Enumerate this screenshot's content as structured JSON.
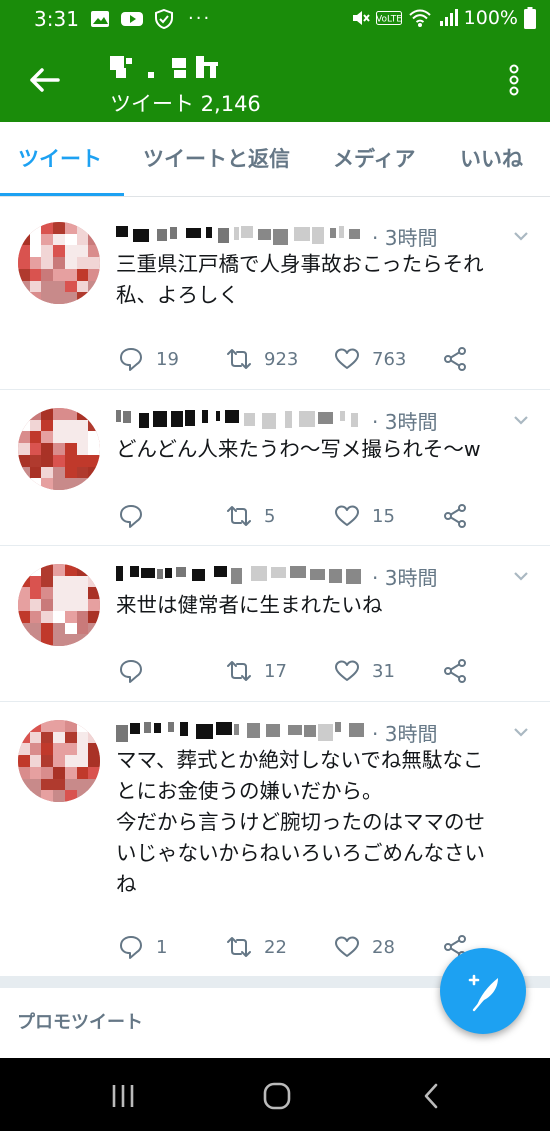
{
  "status_bar": {
    "time": "3:31",
    "battery": "100%",
    "network_badge": "VoLTE",
    "icons_left": [
      "image-icon",
      "youtube-icon",
      "shield-icon",
      "more-dots-icon"
    ],
    "icons_right": [
      "mute-icon",
      "volte-icon",
      "wifi-icon",
      "signal-icon",
      "battery-icon"
    ]
  },
  "app_bar": {
    "title": "",
    "tweet_count": "ツイート 2,146",
    "color": "#1a8c0a"
  },
  "tabs": [
    {
      "label": "ツイート",
      "active": true
    },
    {
      "label": "ツイートと返信",
      "active": false
    },
    {
      "label": "メディア",
      "active": false
    },
    {
      "label": "いいね",
      "active": false
    }
  ],
  "tweets": [
    {
      "time": "· 3時間",
      "text": "三重県江戸橋で人身事故おこったらそれ\n私、よろしく",
      "replies": "19",
      "retweets": "923",
      "likes": "763"
    },
    {
      "time": "· 3時間",
      "text": "どんどん人来たうわ〜写メ撮られそ〜w",
      "replies": "",
      "retweets": "5",
      "likes": "15"
    },
    {
      "time": "· 3時間",
      "text": "来世は健常者に生まれたいね",
      "replies": "",
      "retweets": "17",
      "likes": "31"
    },
    {
      "time": "· 3時間",
      "text": "ママ、葬式とか絶対しないでね無駄なこ\nとにお金使うの嫌いだから。\n今だから言うけど腕切ったのはママのせ\nいじゃないからねいろいろごめんなさい\nね",
      "replies": "1",
      "retweets": "22",
      "likes": "28"
    }
  ],
  "promo": {
    "label": "プロモツイート"
  },
  "colors": {
    "accent": "#1da1f2",
    "header": "#1a8c0a",
    "text": "#14171a",
    "muted": "#657786"
  }
}
